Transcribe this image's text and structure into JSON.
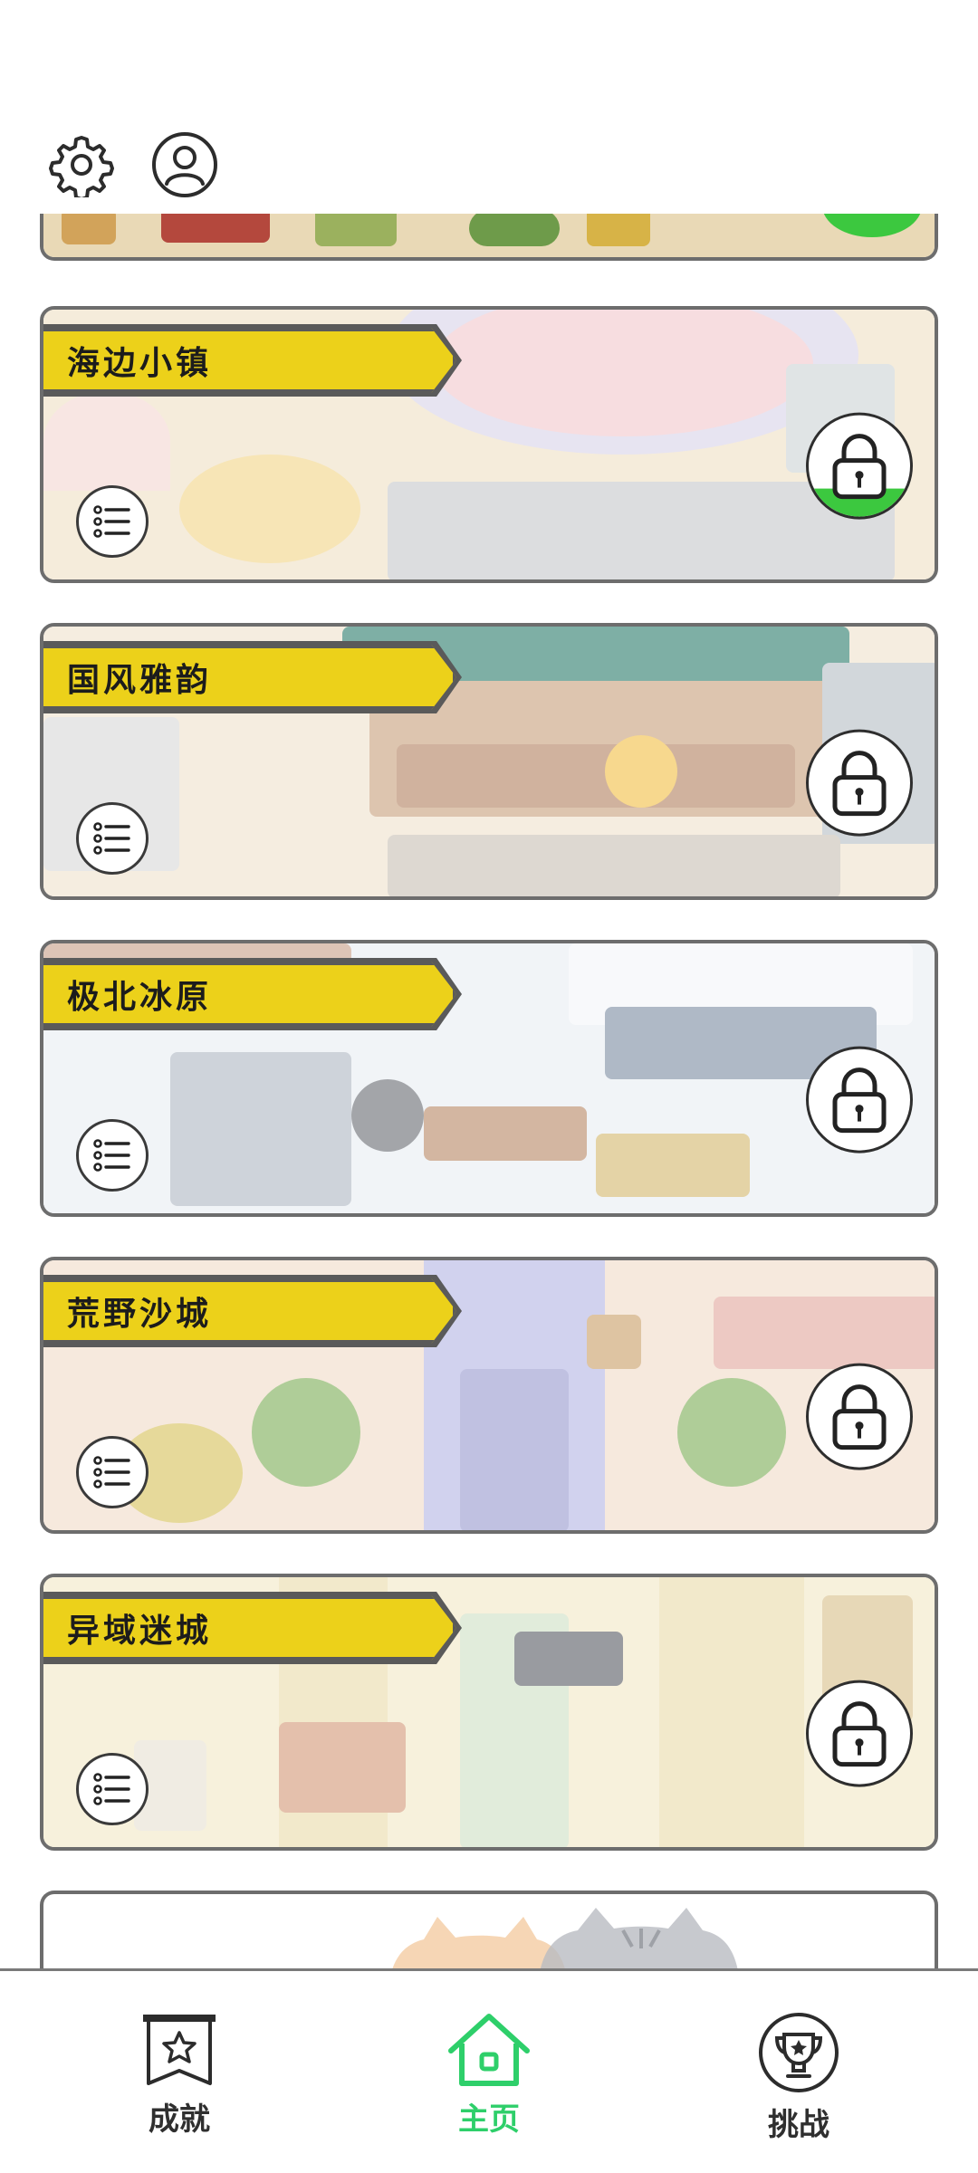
{
  "top_bar": {
    "settings_icon": "gear-icon",
    "profile_icon": "user-icon"
  },
  "levels": [
    {
      "title": "海边小镇",
      "bg": "#efe1c6",
      "accent": "#cfe2e6",
      "lock_progress": 0.28
    },
    {
      "title": "国风雅韵",
      "bg": "#efe2cd",
      "accent": "#b7bfc6",
      "lock_progress": 0
    },
    {
      "title": "极北冰原",
      "bg": "#e8edf3",
      "accent": "#c6d7e4",
      "lock_progress": 0
    },
    {
      "title": "荒野沙城",
      "bg": "#f1dcc9",
      "accent": "#b5b6e4",
      "lock_progress": 0
    },
    {
      "title": "异域迷城",
      "bg": "#f3e9c7",
      "accent": "#e3d8b8",
      "lock_progress": 0
    }
  ],
  "bottom_nav": {
    "achievements": "成就",
    "home": "主页",
    "challenges": "挑战",
    "active": "home",
    "active_color": "#2ecf6a"
  },
  "colors": {
    "title_banner": "#ecd11a",
    "lock_progress": "#3cc83f",
    "border": "#6d6d6d"
  }
}
